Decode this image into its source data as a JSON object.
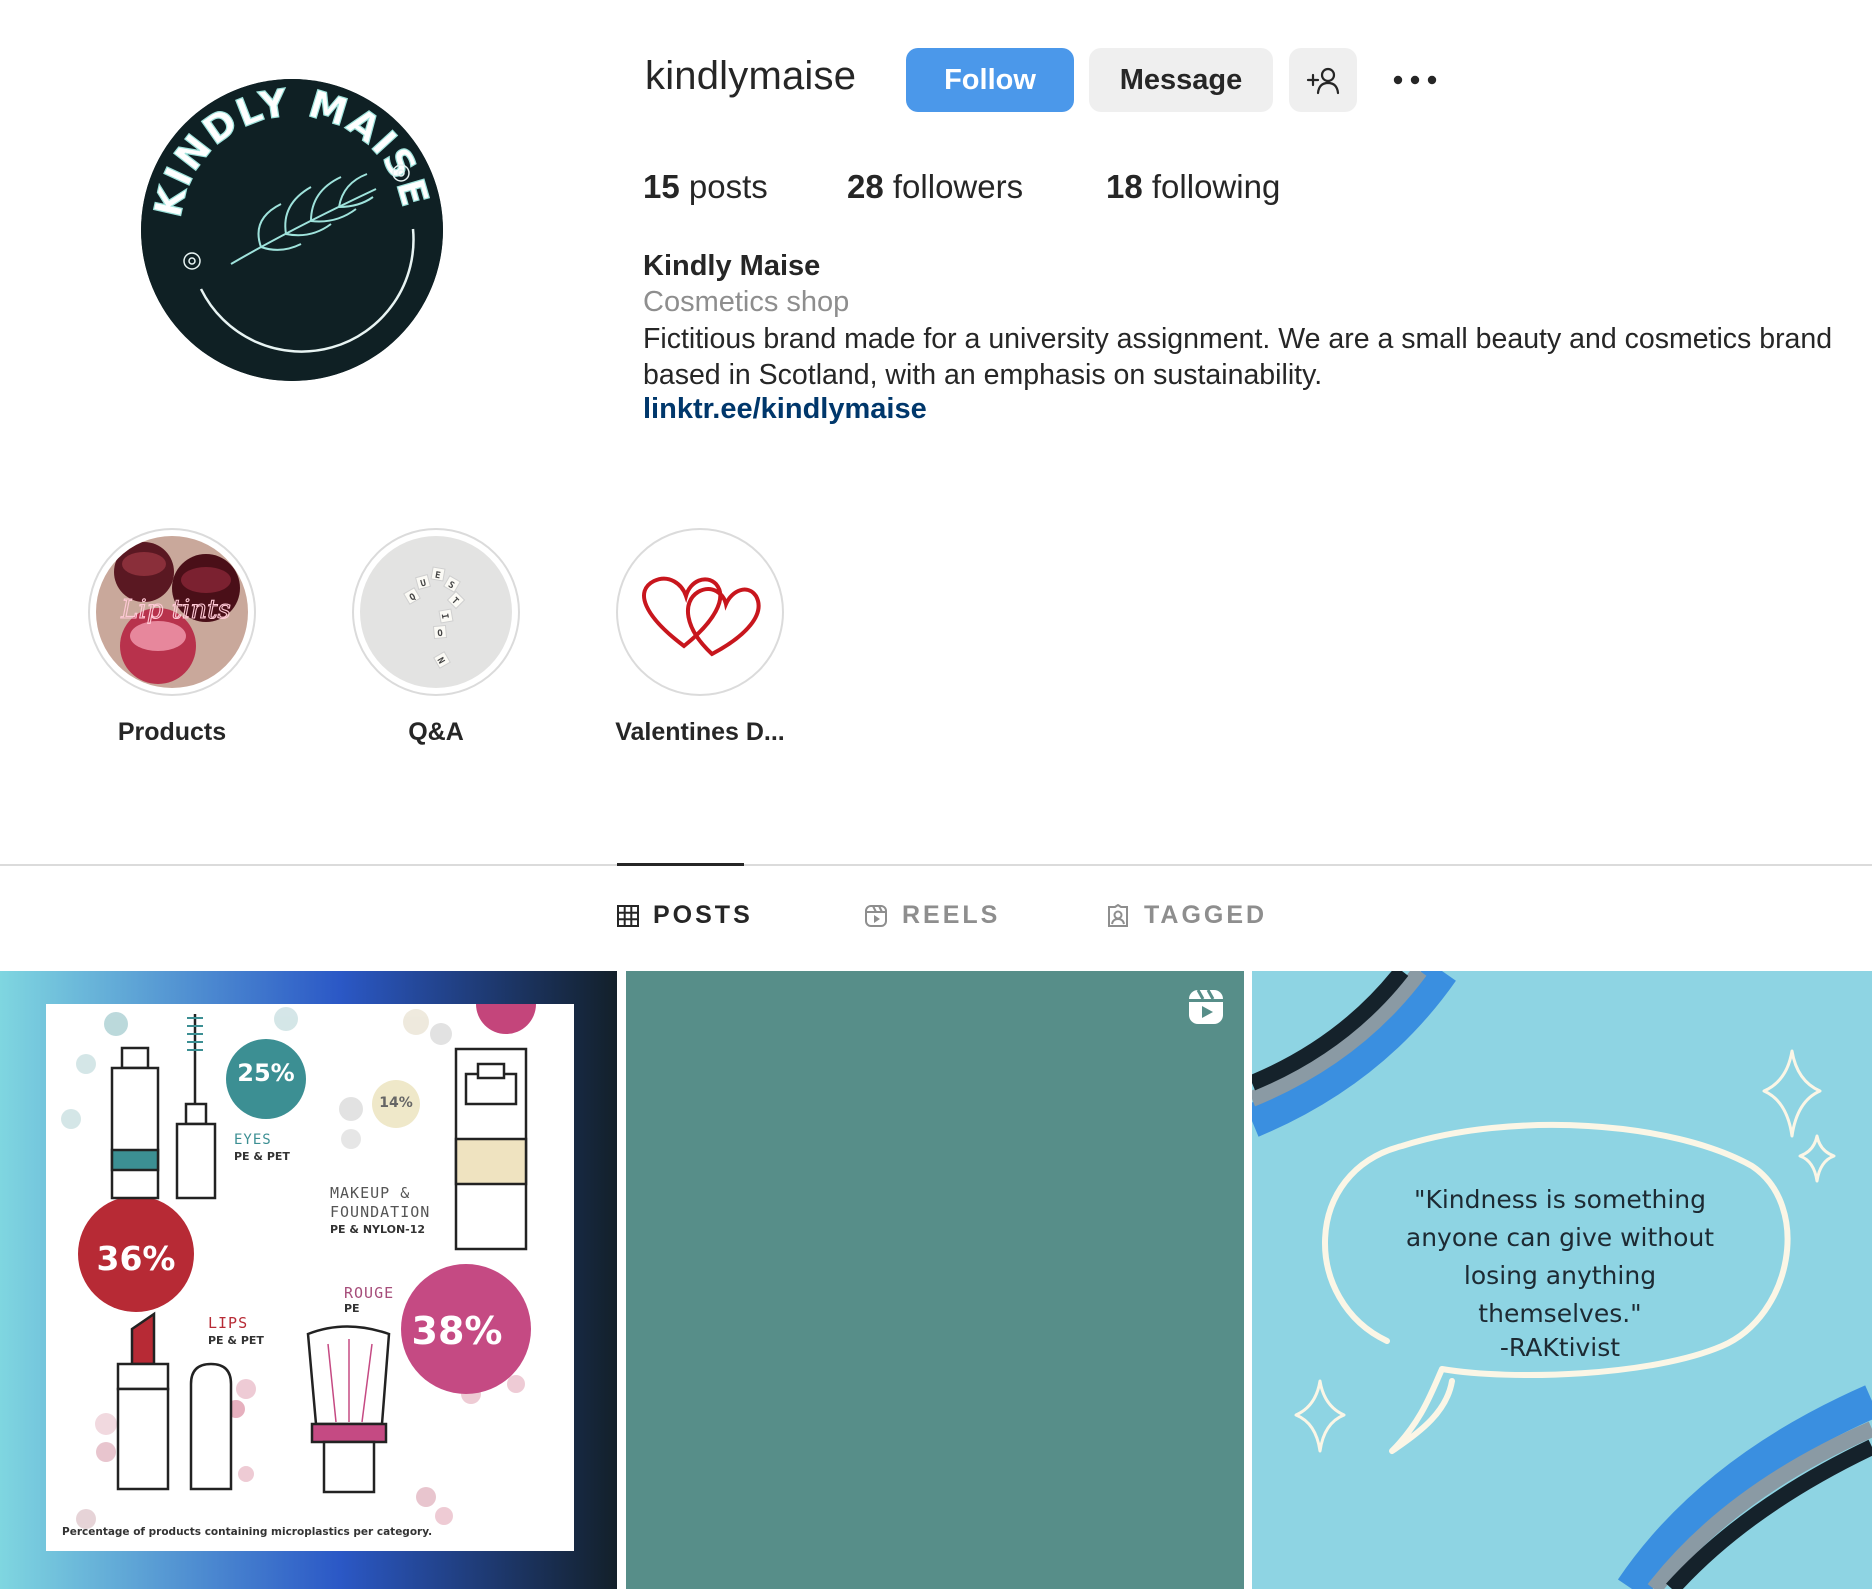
{
  "profile": {
    "username": "kindlymaise",
    "follow_label": "Follow",
    "message_label": "Message",
    "add_user_icon": "add-person-icon",
    "more_icon": "more-horizontal-icon",
    "avatar_text": "KINDLY MAISE",
    "stats": {
      "posts_count": "15",
      "posts_label": "posts",
      "followers_count": "28",
      "followers_label": "followers",
      "following_count": "18",
      "following_label": "following"
    },
    "full_name": "Kindly Maise",
    "category": "Cosmetics shop",
    "bio": "Fictitious brand made for a university assignment. We are a small beauty and cosmetics brand based in Scotland, with an emphasis on sustainability.",
    "link": "linktr.ee/kindlymaise"
  },
  "highlights": [
    {
      "label": "Products",
      "cover_text": "Lip tints"
    },
    {
      "label": "Q&A",
      "cover_text": "QUESTION"
    },
    {
      "label": "Valentines D...",
      "cover_text": ""
    }
  ],
  "tabs": [
    {
      "label": "POSTS",
      "icon": "grid-icon",
      "active": true
    },
    {
      "label": "REELS",
      "icon": "reels-icon",
      "active": false
    },
    {
      "label": "TAGGED",
      "icon": "tagged-icon",
      "active": false
    }
  ],
  "posts": {
    "infographic": {
      "eyes_pct": "25%",
      "eyes_label": "EYES",
      "eyes_sub": "PE & PET",
      "makeup_pct": "14%",
      "makeup_label_1": "MAKEUP &",
      "makeup_label_2": "FOUNDATION",
      "makeup_sub": "PE & NYLON-12",
      "lips_pct": "36%",
      "lips_label": "LIPS",
      "lips_sub": "PE & PET",
      "rouge_label": "ROUGE",
      "rouge_sub": "PE",
      "rouge_pct": "38%",
      "caption": "Percentage of products containing microplastics per category."
    },
    "reel": {
      "badge_icon": "reel-badge-icon"
    },
    "quote": {
      "text": "\"Kindness is something anyone can give without losing anything themselves.\"",
      "author": "-RAKtivist"
    }
  },
  "colors": {
    "follow_button": "#4b98ea",
    "link": "#00376b",
    "avatar_bg": "#0f2024",
    "avatar_accent": "#9fe3dc",
    "reel_post_bg": "#578e89",
    "quote_post_bg": "#8ed4e3"
  }
}
